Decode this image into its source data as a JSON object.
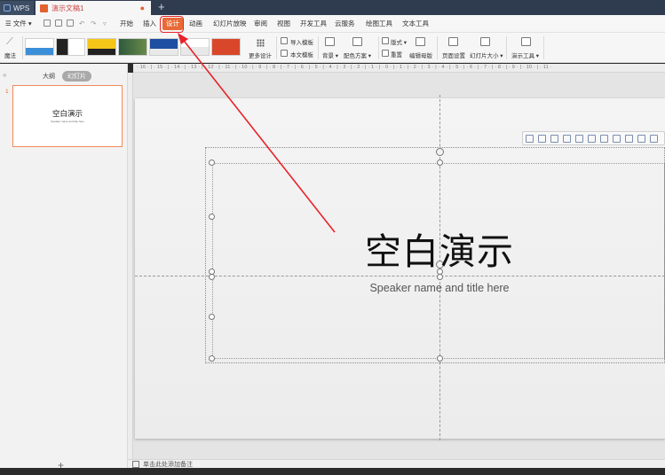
{
  "tabs": {
    "app": "WPS",
    "document": "演示文稿1",
    "add": "+"
  },
  "menu": {
    "file": "☰ 文件 ▾",
    "items": [
      "开始",
      "插入",
      "设计",
      "动画",
      "幻灯片放映",
      "审阅",
      "视图",
      "开发工具",
      "云服务",
      "绘图工具",
      "文本工具"
    ],
    "active": "设计"
  },
  "ribbon": {
    "magic": "魔法",
    "more_design": "更多设计",
    "import_template": "导入模板",
    "text_template": "本文模板",
    "background": "背景 ▾",
    "color_scheme": "配色方案 ▾",
    "layout": "版式 ▾",
    "reset": "重置",
    "edit_master": "编辑母版",
    "page_setup": "页面设置",
    "slide_size": "幻灯片大小 ▾",
    "presentation_tools": "演示工具 ▾"
  },
  "left_pane": {
    "collapse": "«",
    "tab_outline": "大纲",
    "tab_slides": "幻灯片",
    "slide_number": "1",
    "thumb_title": "空白演示",
    "thumb_subtitle": "Speaker name and title here",
    "add": "+"
  },
  "ruler": "· 16 · | · 15 · | · 14 · | · 13 · | · 12 · | · 11 · | · 10 · | · 9 · | · 8 · | · 7 · | · 6 · | · 5 · | · 4 · | · 3 · | · 2 · | · 1 · | · 0 · | · 1 · | · 2 · | · 3 · | · 4 · | · 5 · | · 6 · | · 7 · | · 8 · | · 9 · | · 10 · | · 11 ·",
  "slide": {
    "title": "空白演示",
    "subtitle": "Speaker name and title here"
  },
  "notes": {
    "placeholder": "单击此处添加备注"
  },
  "colors": {
    "accent": "#e86b37",
    "annotation": "#e8232a"
  }
}
